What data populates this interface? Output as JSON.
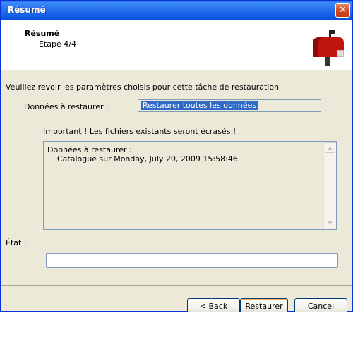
{
  "window": {
    "title": "Résumé",
    "close_symbol": "✕",
    "accent_color": "#0a5ae6"
  },
  "header": {
    "title": "Résumé",
    "step": "Etape 4/4",
    "icon": "mailbox-icon"
  },
  "content": {
    "intro": "Veuillez revoir les paramètres choisis pour cette tâche de restauration",
    "data_label": "Données à restaurer :",
    "data_value": "Restaurer toutes les données",
    "warning": "Important ! Les fichiers existants seront écrasés !",
    "summary_line1": "Données à restaurer :",
    "summary_line2": "Catalogue sur Monday, July 20, 2009 15:58:46",
    "etat_label": "État :",
    "etat_value": ""
  },
  "buttons": {
    "back": "< Back",
    "restore": "Restaurer",
    "cancel": "Cancel"
  }
}
